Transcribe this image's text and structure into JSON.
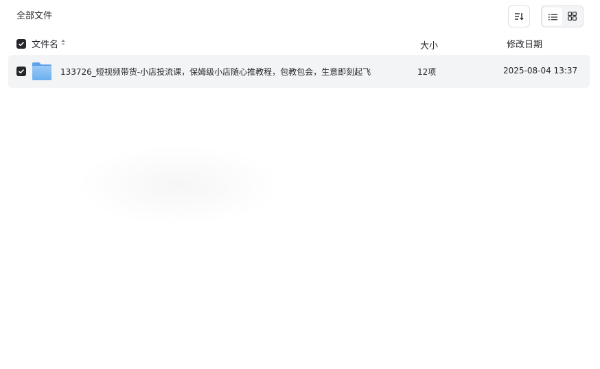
{
  "breadcrumb": {
    "title": "全部文件"
  },
  "toolbar": {
    "sort_icon": "sort-icon",
    "view_list_icon": "list-view-icon",
    "view_grid_icon": "grid-view-icon",
    "active_view": "list"
  },
  "table": {
    "columns": {
      "name": "文件名",
      "size": "大小",
      "date": "修改日期"
    },
    "rows": [
      {
        "icon": "folder-icon",
        "name": "133726_短视频带货-小店投流课，保姆级小店随心推教程，包教包会，生意即刻起飞",
        "size": "12项",
        "date": "2025-08-04 13:37",
        "selected": true
      }
    ]
  },
  "colors": {
    "text": "#25262b",
    "row_bg": "#f3f4f5",
    "folder": "#7fb8ef"
  }
}
